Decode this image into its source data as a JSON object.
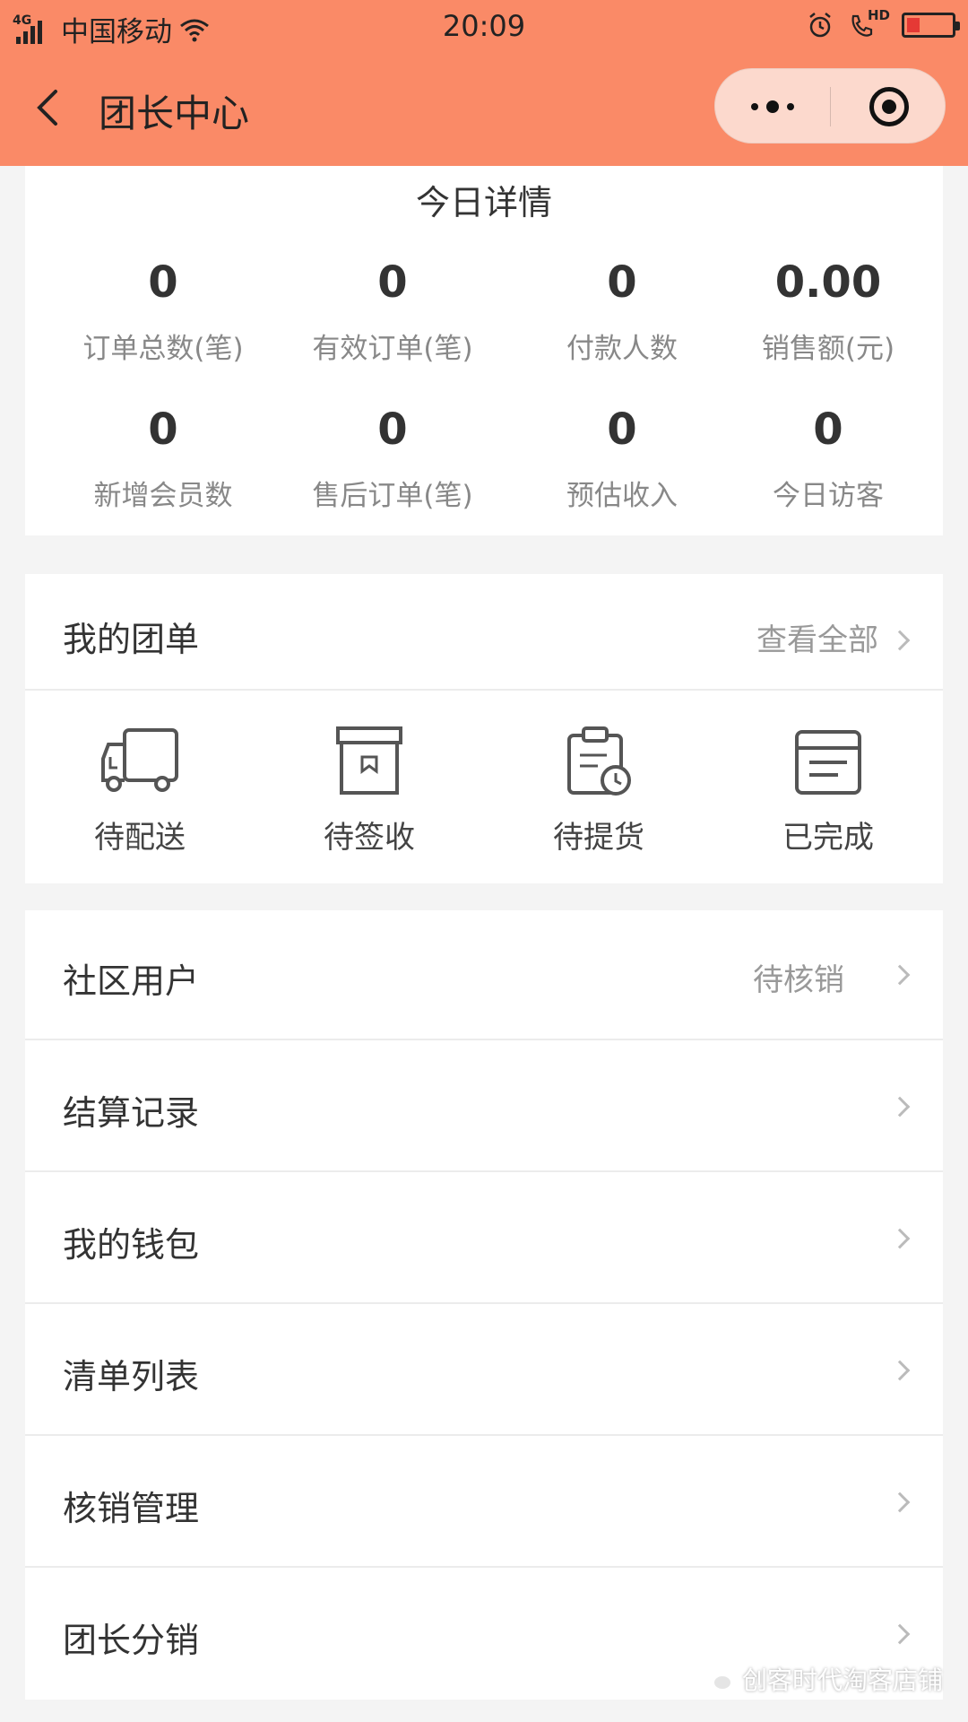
{
  "status_bar": {
    "network": "4G",
    "carrier": "中国移动",
    "time": "20:09",
    "hd_label": "HD"
  },
  "nav": {
    "title": "团长中心"
  },
  "today": {
    "title": "今日详情",
    "stats": [
      {
        "value": "0",
        "label": "订单总数(笔)"
      },
      {
        "value": "0",
        "label": "有效订单(笔)"
      },
      {
        "value": "0",
        "label": "付款人数"
      },
      {
        "value": "0.00",
        "label": "销售额(元)"
      },
      {
        "value": "0",
        "label": "新增会员数"
      },
      {
        "value": "0",
        "label": "售后订单(笔)"
      },
      {
        "value": "0",
        "label": "预估收入"
      },
      {
        "value": "0",
        "label": "今日访客"
      }
    ]
  },
  "orders": {
    "title": "我的团单",
    "view_all": "查看全部",
    "statuses": [
      {
        "label": "待配送",
        "icon": "truck-icon"
      },
      {
        "label": "待签收",
        "icon": "box-icon"
      },
      {
        "label": "待提货",
        "icon": "clipboard-clock-icon"
      },
      {
        "label": "已完成",
        "icon": "tray-icon"
      }
    ]
  },
  "menu": {
    "items": [
      {
        "label": "社区用户",
        "extra": "待核销"
      },
      {
        "label": "结算记录",
        "extra": ""
      },
      {
        "label": "我的钱包",
        "extra": ""
      },
      {
        "label": "清单列表",
        "extra": ""
      },
      {
        "label": "核销管理",
        "extra": ""
      },
      {
        "label": "团长分销",
        "extra": ""
      }
    ]
  },
  "watermark": {
    "text": "创客时代淘客店铺"
  },
  "colors": {
    "header": "#fa8a67",
    "capsule": "#fcd9cd",
    "background": "#f4f4f4"
  }
}
